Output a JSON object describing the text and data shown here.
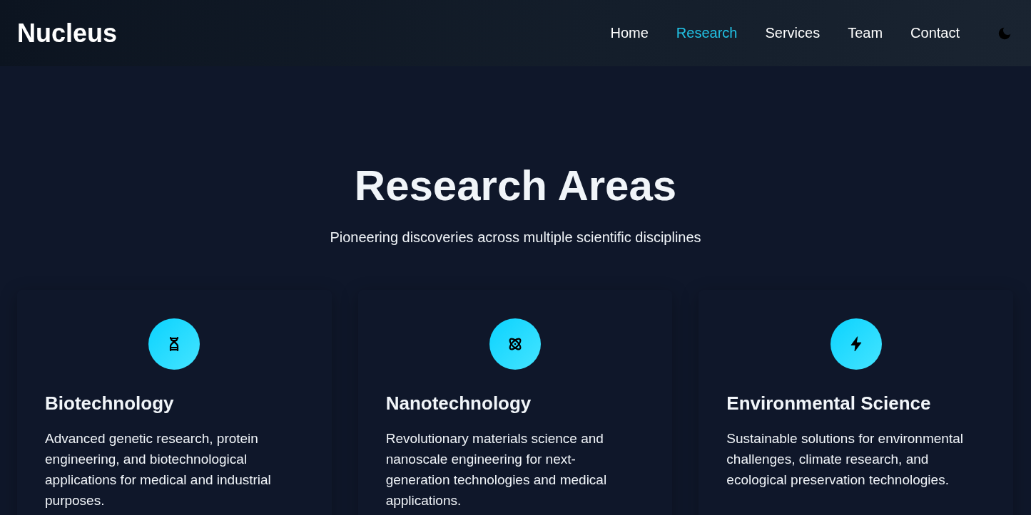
{
  "header": {
    "logo": "Nucleus",
    "nav": [
      {
        "label": "Home",
        "selected": false
      },
      {
        "label": "Research",
        "selected": true
      },
      {
        "label": "Services",
        "selected": false
      },
      {
        "label": "Team",
        "selected": false
      },
      {
        "label": "Contact",
        "selected": false
      }
    ]
  },
  "hero": {
    "title": "Research Areas",
    "subtitle": "Pioneering discoveries across multiple scientific disciplines"
  },
  "cards": [
    {
      "title": "Biotechnology",
      "description": "Advanced genetic research, protein engineering, and biotechnological applications for medical and industrial purposes."
    },
    {
      "title": "Nanotechnology",
      "description": "Revolutionary materials science and nanoscale engineering for next-generation technologies and medical applications."
    },
    {
      "title": "Environmental Science",
      "description": "Sustainable solutions for environmental challenges, climate research, and ecological preservation technologies."
    }
  ]
}
